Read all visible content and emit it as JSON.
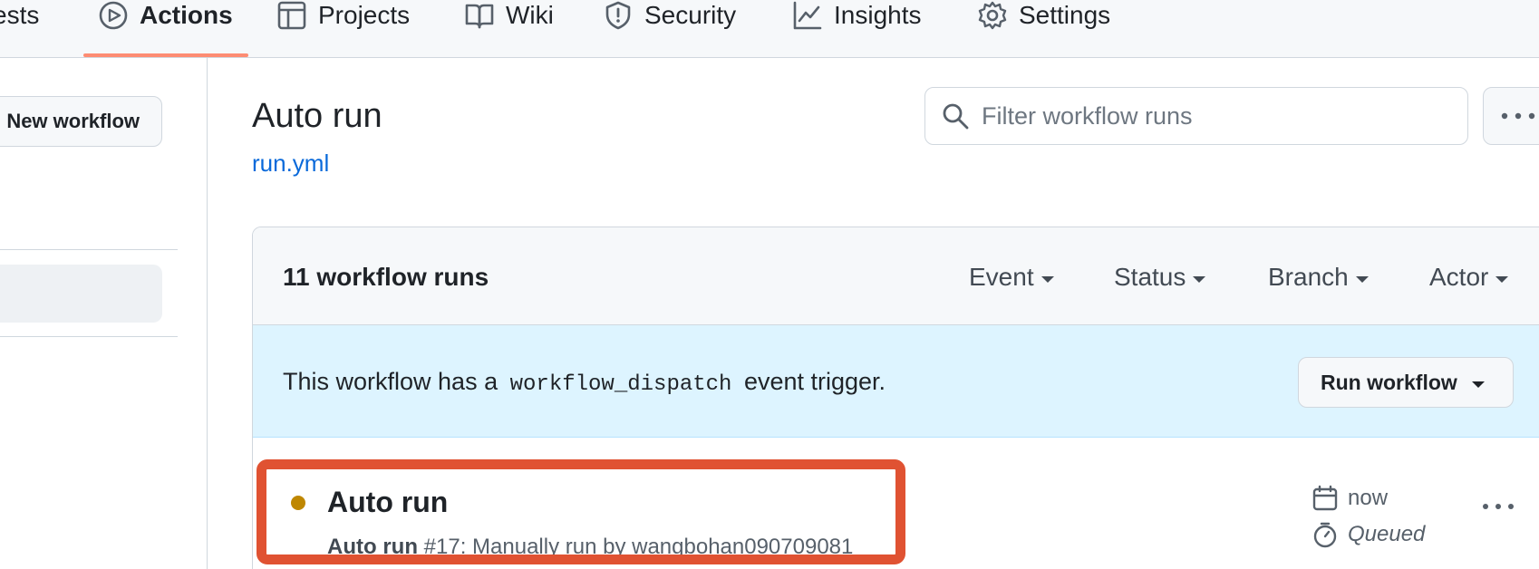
{
  "nav": {
    "tabs": [
      {
        "label": "ests",
        "icon": "pull-request-icon"
      },
      {
        "label": "Actions",
        "icon": "play-icon",
        "active": true
      },
      {
        "label": "Projects",
        "icon": "table-icon"
      },
      {
        "label": "Wiki",
        "icon": "book-icon"
      },
      {
        "label": "Security",
        "icon": "shield-icon"
      },
      {
        "label": "Insights",
        "icon": "graph-icon"
      },
      {
        "label": "Settings",
        "icon": "gear-icon"
      }
    ],
    "active_color": "#fd8c73"
  },
  "sidebar": {
    "new_workflow_label": "New workflow"
  },
  "header": {
    "title": "Auto run",
    "workflow_file": "run.yml",
    "filter_placeholder": "Filter workflow runs"
  },
  "runs": {
    "count_label": "11 workflow runs",
    "filters": [
      "Event",
      "Status",
      "Branch",
      "Actor"
    ],
    "dispatch": {
      "prefix": "This workflow has a",
      "code": "workflow_dispatch",
      "suffix": "event trigger."
    },
    "run_workflow_label": "Run workflow",
    "items": [
      {
        "title": "Auto run",
        "sub_name": "Auto run",
        "sub_detail": "#17: Manually run by wangbohan090709081",
        "time": "now",
        "status": "Queued",
        "status_color": "#bf8700"
      }
    ]
  },
  "colors": {
    "link": "#0969da",
    "highlight": "#e05232",
    "banner": "#ddf4ff"
  }
}
